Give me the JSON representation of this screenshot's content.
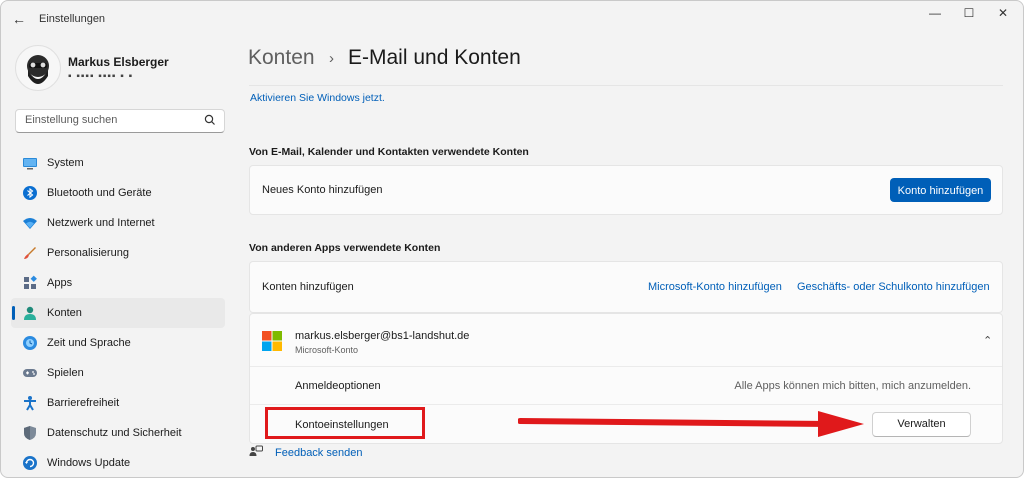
{
  "window": {
    "title": "Einstellungen",
    "back_glyph": "←",
    "minimize_glyph": "—",
    "maximize_glyph": "☐",
    "close_glyph": "✕"
  },
  "profile": {
    "name": "Markus Elsberger",
    "email_masked": "▪ ▪▪▪▪ ▪▪▪▪  ▪   ▪"
  },
  "search": {
    "placeholder": "Einstellung suchen",
    "icon": "search-icon"
  },
  "sidebar": {
    "items": [
      {
        "label": "System",
        "icon": "monitor-icon"
      },
      {
        "label": "Bluetooth und Geräte",
        "icon": "bluetooth-icon"
      },
      {
        "label": "Netzwerk und Internet",
        "icon": "wifi-icon"
      },
      {
        "label": "Personalisierung",
        "icon": "brush-icon"
      },
      {
        "label": "Apps",
        "icon": "apps-icon"
      },
      {
        "label": "Konten",
        "icon": "person-icon",
        "active": true
      },
      {
        "label": "Zeit und Sprache",
        "icon": "globe-clock-icon"
      },
      {
        "label": "Spielen",
        "icon": "gamepad-icon"
      },
      {
        "label": "Barrierefreiheit",
        "icon": "accessibility-icon"
      },
      {
        "label": "Datenschutz und Sicherheit",
        "icon": "shield-icon"
      },
      {
        "label": "Windows Update",
        "icon": "update-icon"
      }
    ]
  },
  "breadcrumb": {
    "parent": "Konten",
    "separator": "›",
    "current": "E-Mail und Konten"
  },
  "activate_link": "Aktivieren Sie Windows jetzt.",
  "section_email": {
    "heading": "Von E-Mail, Kalender und Kontakten verwendete Konten",
    "row_label": "Neues Konto hinzufügen",
    "button": "Konto hinzufügen"
  },
  "section_apps": {
    "heading": "Von anderen Apps verwendete Konten",
    "row_label": "Konten hinzufügen",
    "link_microsoft": "Microsoft-Konto hinzufügen",
    "link_work": "Geschäfts- oder Schulkonto hinzufügen"
  },
  "account": {
    "email": "markus.elsberger@bs1-landshut.de",
    "type": "Microsoft-Konto",
    "chevron": "⌄",
    "signin_label": "Anmeldeoptionen",
    "signin_value": "Alle Apps können mich bitten, mich anzumelden.",
    "settings_label": "Kontoeinstellungen",
    "manage_button": "Verwalten"
  },
  "feedback": "Feedback senden",
  "colors": {
    "accent": "#005fb8",
    "annotation": "#e0191b"
  }
}
